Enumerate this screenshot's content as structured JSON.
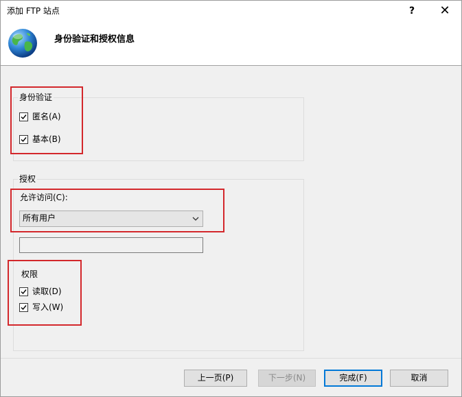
{
  "window": {
    "title": "添加 FTP 站点",
    "help_label": "?",
    "close_label": "✕"
  },
  "header": {
    "title": "身份验证和授权信息",
    "icon": "globe-icon"
  },
  "authentication": {
    "legend": "身份验证",
    "anonymous": {
      "label": "匿名(A)",
      "checked": true
    },
    "basic": {
      "label": "基本(B)",
      "checked": true
    }
  },
  "authorization": {
    "legend": "授权",
    "allow_access_label": "允许访问(C):",
    "allow_access_value": "所有用户",
    "user_input_value": "",
    "permissions_label": "权限",
    "read": {
      "label": "读取(D)",
      "checked": true
    },
    "write": {
      "label": "写入(W)",
      "checked": true
    }
  },
  "buttons": {
    "previous": "上一页(P)",
    "next": "下一步(N)",
    "finish": "完成(F)",
    "cancel": "取消"
  },
  "colors": {
    "highlight": "#d3262a",
    "default_button_border": "#0078d7",
    "dialog_background": "#f0f0f0"
  }
}
